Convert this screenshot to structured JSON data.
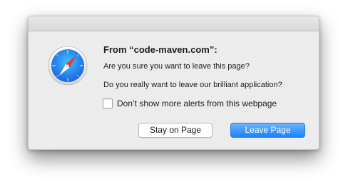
{
  "dialog": {
    "title": "From “code-maven.com”:",
    "message_1": "Are you sure you want to leave this page?",
    "message_2": "Do you really want to leave our brilliant application?",
    "checkbox": {
      "label": "Don’t show more alerts from this webpage",
      "checked": false
    },
    "buttons": {
      "stay_label": "Stay on Page",
      "leave_label": "Leave Page"
    },
    "icon": "safari-compass-icon"
  },
  "colors": {
    "dialog_background": "#ececec",
    "default_button": "#1a82fb"
  }
}
